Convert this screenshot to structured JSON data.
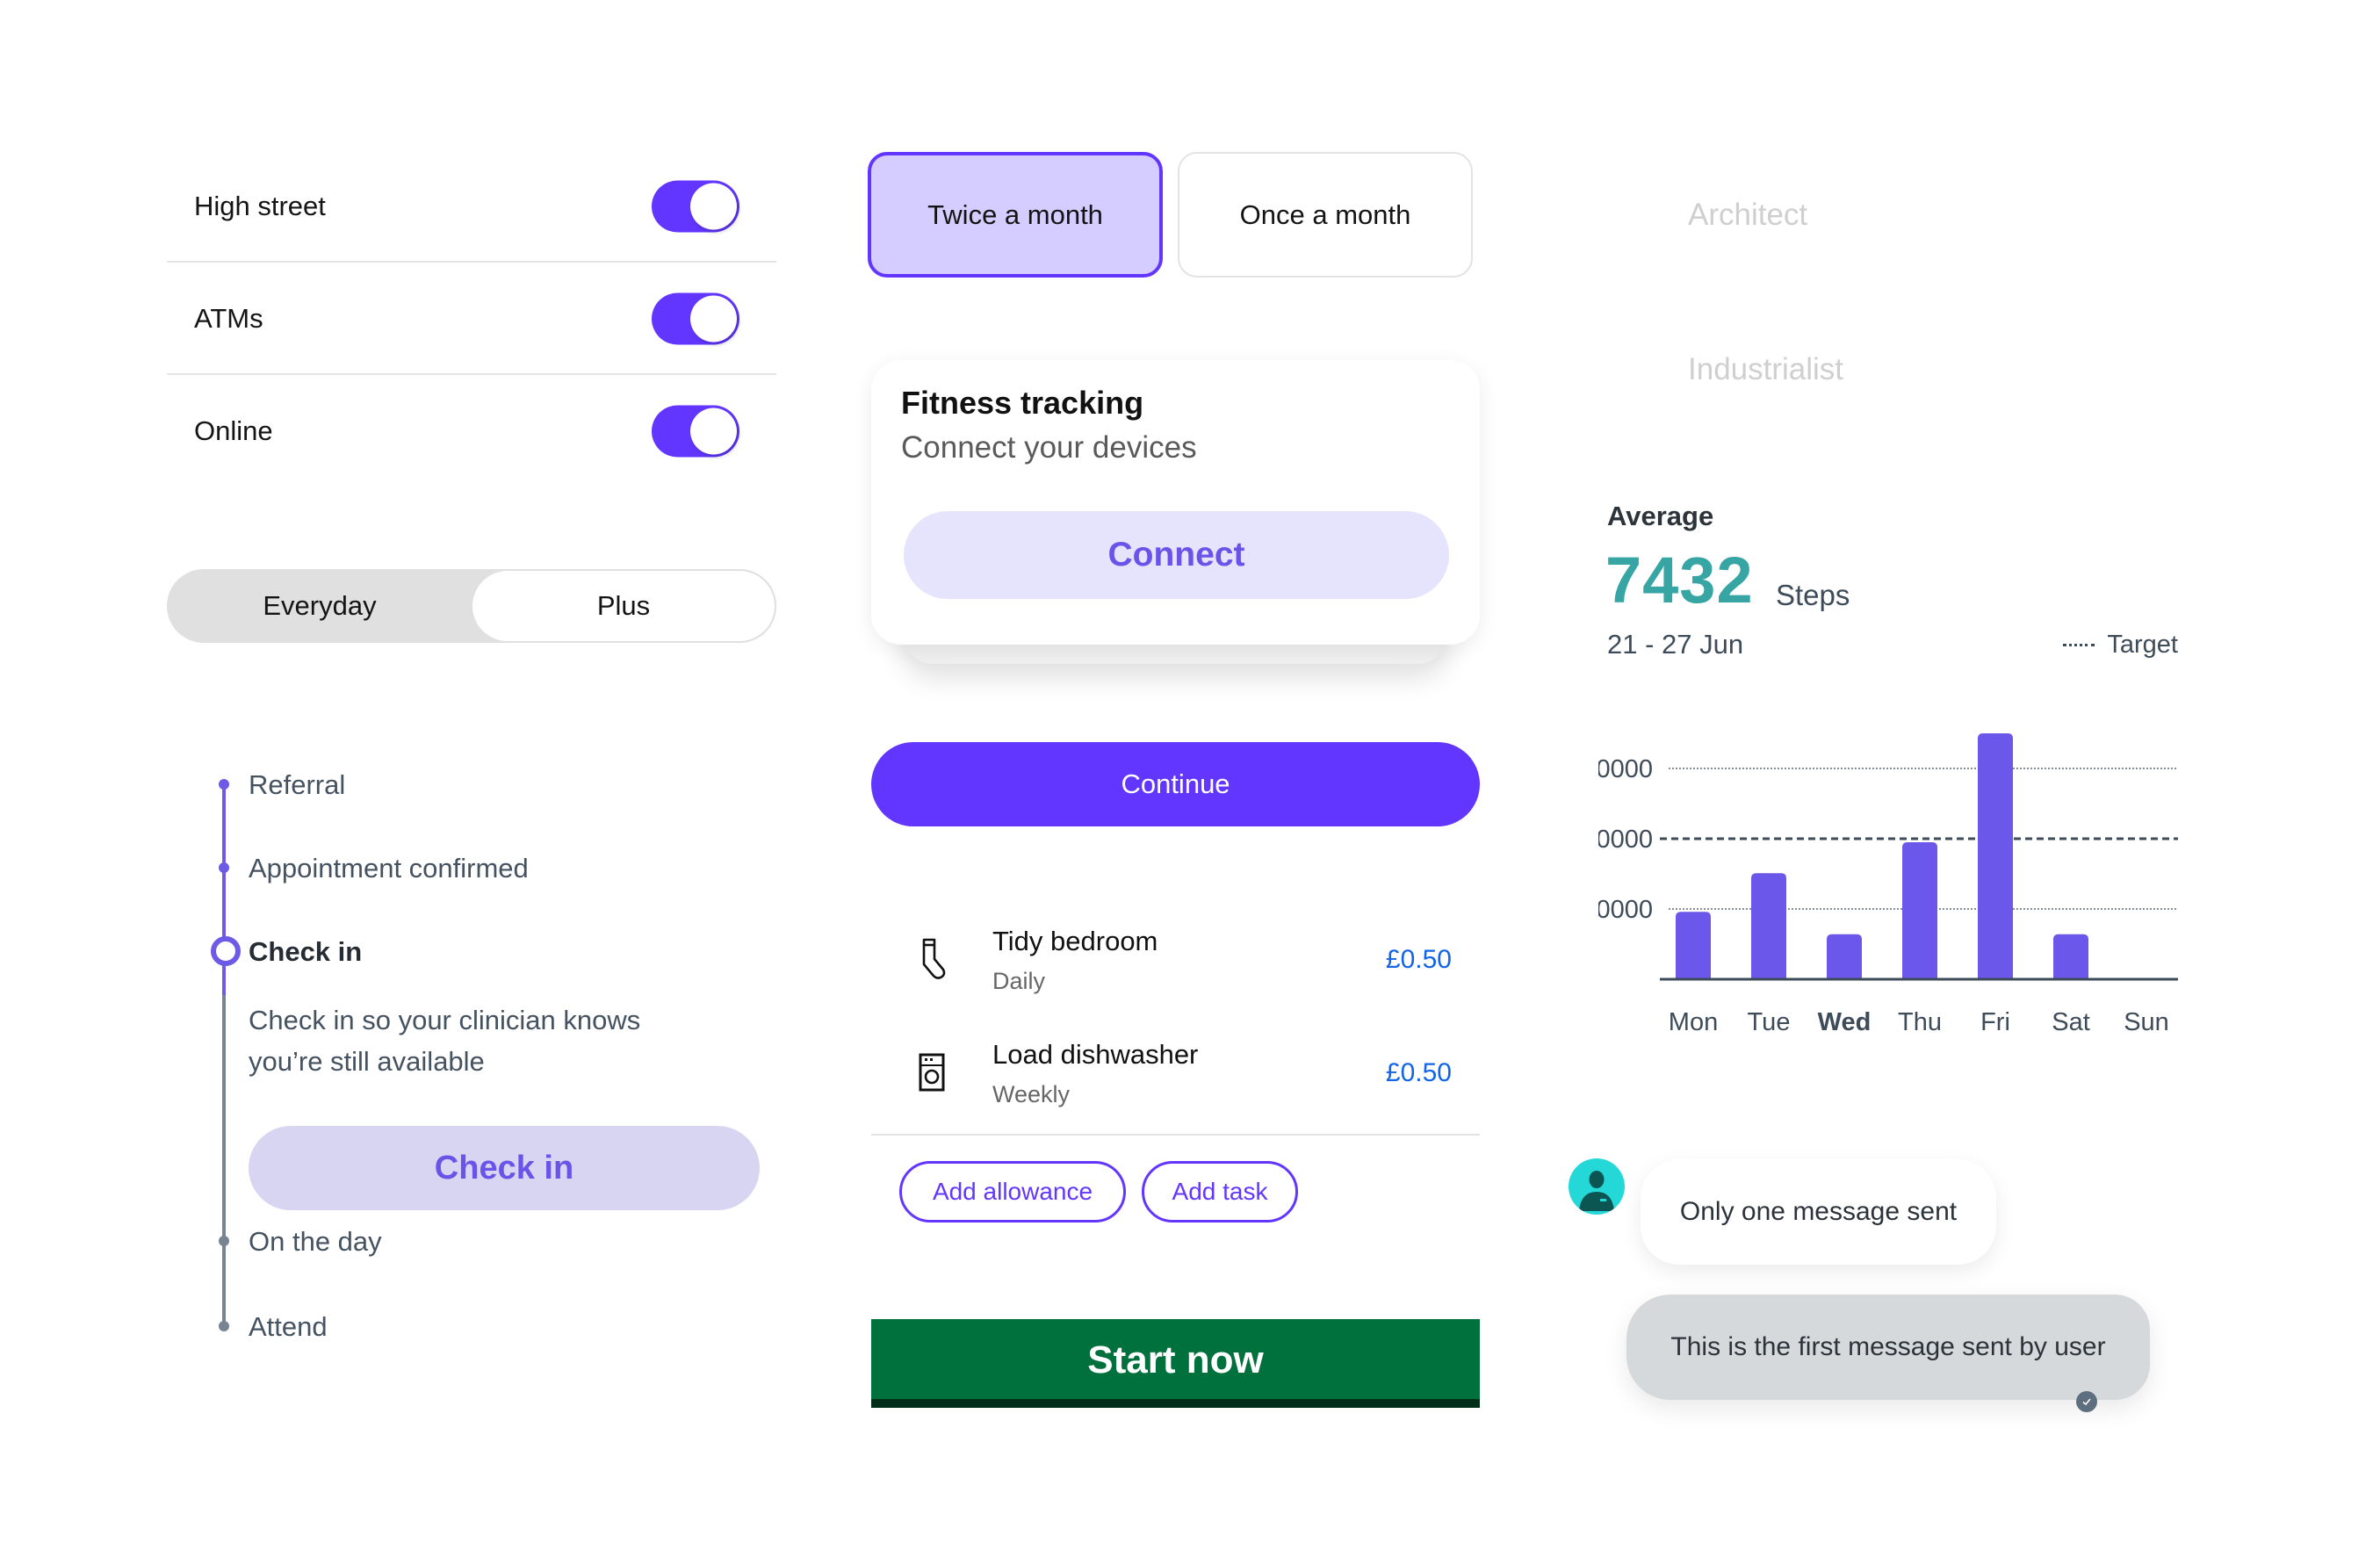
{
  "colors": {
    "brand_purple": "#6236ff",
    "bar_purple": "#6b57e9",
    "teal": "#36a5a3",
    "govuk_green": "#00703c",
    "link_blue": "#1265e6"
  },
  "toggles": [
    {
      "label": "High street",
      "on": true
    },
    {
      "label": "ATMs",
      "on": true
    },
    {
      "label": "Online",
      "on": true
    }
  ],
  "segmented": {
    "options": [
      "Everyday",
      "Plus"
    ],
    "selected": "Plus"
  },
  "timeline": {
    "steps": [
      {
        "label": "Referral",
        "state": "done"
      },
      {
        "label": "Appointment confirmed",
        "state": "done"
      },
      {
        "label": "Check in",
        "state": "current"
      },
      {
        "label": "On the day",
        "state": "upcoming"
      },
      {
        "label": "Attend",
        "state": "upcoming"
      }
    ],
    "current_description_line1": "Check in so your clinician knows",
    "current_description_line2": "you’re still available",
    "action_label": "Check in"
  },
  "frequency": {
    "options": [
      "Twice a month",
      "Once a month"
    ],
    "selected": "Twice a month"
  },
  "fitness_card": {
    "title": "Fitness tracking",
    "subtitle": "Connect your devices",
    "button": "Connect"
  },
  "continue_label": "Continue",
  "tasks": [
    {
      "name": "Tidy bedroom",
      "frequency": "Daily",
      "price": "£0.50",
      "icon": "sock-icon"
    },
    {
      "name": "Load dishwasher",
      "frequency": "Weekly",
      "price": "£0.50",
      "icon": "dishwasher-icon"
    }
  ],
  "task_actions": [
    "Add allowance",
    "Add task"
  ],
  "start_now_label": "Start now",
  "words": [
    "Architect",
    "Industrialist"
  ],
  "stats": {
    "label": "Average",
    "value": "7432",
    "unit": "Steps",
    "date_range": "21 - 27 Jun",
    "legend": "Target"
  },
  "chart_data": {
    "type": "bar",
    "title": "",
    "xlabel": "",
    "ylabel": "",
    "categories": [
      "Mon",
      "Tue",
      "Wed",
      "Thu",
      "Fri",
      "Sat",
      "Sun"
    ],
    "values": [
      0.96,
      1.51,
      0.64,
      1.95,
      3.5,
      0.64,
      0
    ],
    "value_units": "gridline intervals (tick labels are placeholder '0000')",
    "y_ticks": [
      {
        "value": 1,
        "label": "0000"
      },
      {
        "value": 2,
        "label": "0000"
      },
      {
        "value": 3,
        "label": "0000"
      }
    ],
    "target": 2,
    "target_label": "Target",
    "highlighted_category": "Wed",
    "ylim": [
      0,
      3.6
    ],
    "grid": true,
    "legend": "top-right"
  },
  "chat": {
    "incoming": "Only one message sent",
    "outgoing": "This is the first message sent by user",
    "outgoing_status": "delivered"
  }
}
